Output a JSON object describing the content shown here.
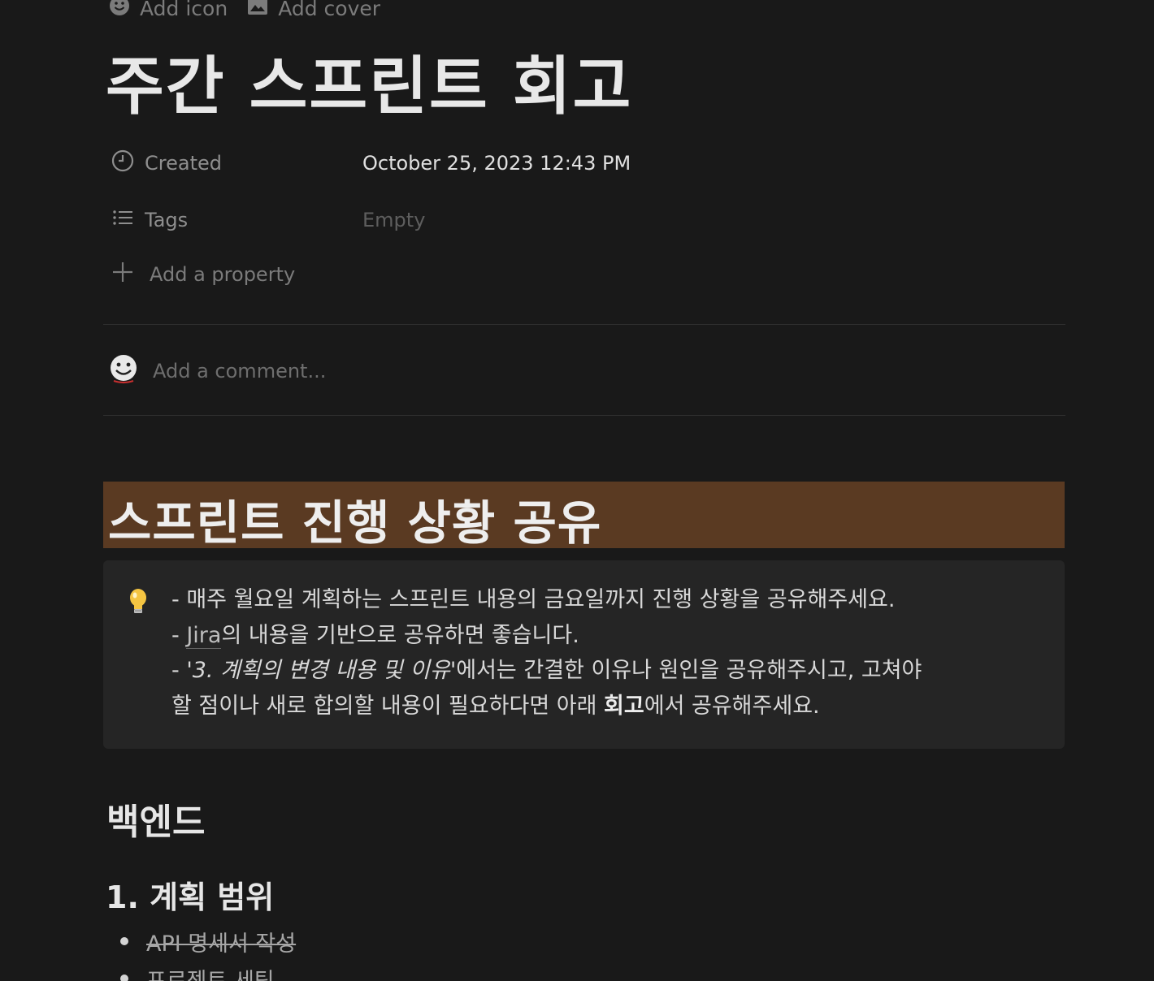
{
  "top_actions": {
    "add_icon": "Add icon",
    "add_cover": "Add cover"
  },
  "page": {
    "title": "주간 스프린트 회고"
  },
  "properties": [
    {
      "icon": "clock-icon",
      "label": "Created",
      "value": "October 25, 2023 12:43 PM"
    },
    {
      "icon": "list-icon",
      "label": "Tags",
      "value": "Empty"
    }
  ],
  "add_property": "Add a property",
  "comment": {
    "placeholder": "Add a comment..."
  },
  "section": {
    "heading": "스프린트 진행 상황 공유",
    "background": "#5a3a22"
  },
  "callout": {
    "icon": "lightbulb-icon",
    "line1": "- 매주 월요일 계획하는 스프린트 내용의 금요일까지 진행 상황을 공유해주세요.",
    "line2_prefix": "- ",
    "line2_link": "Jira",
    "line2_suffix": "의 내용을 기반으로 공유하면 좋습니다.",
    "line3_prefix": "- ",
    "line3_italic": "'3. 계획의 변경 내용 및 이유'",
    "line3_suffix": "에서는 간결한 이유나 원인을 공유해주시고, 고쳐야",
    "line4_prefix": "할 점이나 새로 합의할 내용이 필요하다면 아래 ",
    "line4_bold": "회고",
    "line4_suffix": "에서 공유해주세요."
  },
  "content": {
    "h2": "백엔드",
    "h3": "1. 계획 범위",
    "bullets": [
      {
        "text": "API 명세서 작성",
        "done": true
      },
      {
        "text": "프로젝트 세팅",
        "done": true
      }
    ]
  }
}
